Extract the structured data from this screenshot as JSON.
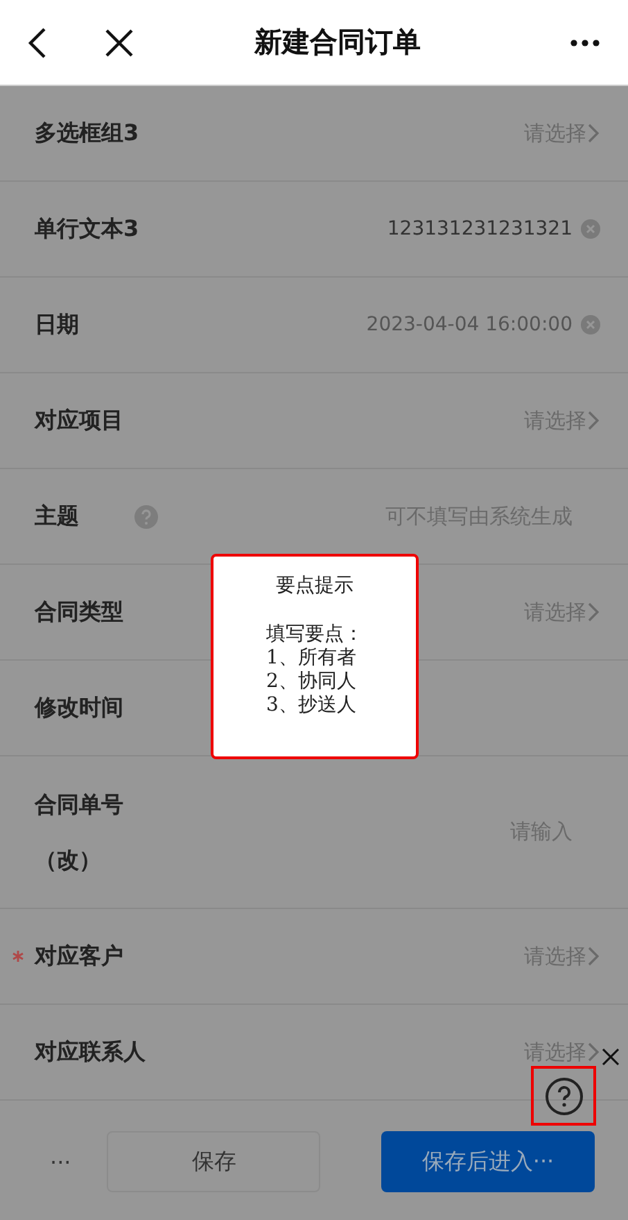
{
  "header": {
    "title": "新建合同订单"
  },
  "fields": [
    {
      "kind": "select",
      "label": "多选框组3",
      "required": false,
      "placeholder": "请选择"
    },
    {
      "kind": "text",
      "label": "单行文本3",
      "required": false,
      "value": "123131231231321"
    },
    {
      "kind": "text",
      "label": "日期",
      "required": false,
      "value": "2023-04-04  16:00:00"
    },
    {
      "kind": "select",
      "label": "对应项目",
      "required": false,
      "placeholder": "请选择"
    },
    {
      "kind": "hint",
      "label": "主题",
      "required": false,
      "placeholder": "可不填写由系统生成"
    },
    {
      "kind": "select",
      "label": "合同类型",
      "required": false,
      "placeholder": "请选择"
    },
    {
      "kind": "empty",
      "label": "修改时间",
      "required": false
    },
    {
      "kind": "input",
      "label": "合同单号",
      "label_cont": "（改）",
      "required": false,
      "placeholder": "请输入"
    },
    {
      "kind": "select",
      "label": "对应客户",
      "required": true,
      "placeholder": "请选择"
    },
    {
      "kind": "select",
      "label": "对应联系人",
      "required": false,
      "placeholder": "请选择"
    }
  ],
  "tip": {
    "title": "要点提示",
    "body": "填写要点：\n1、所有者\n2、协同人\n3、抄送人"
  },
  "footer": {
    "more": "···",
    "save": "保存",
    "save_enter": "保存后进入···"
  }
}
